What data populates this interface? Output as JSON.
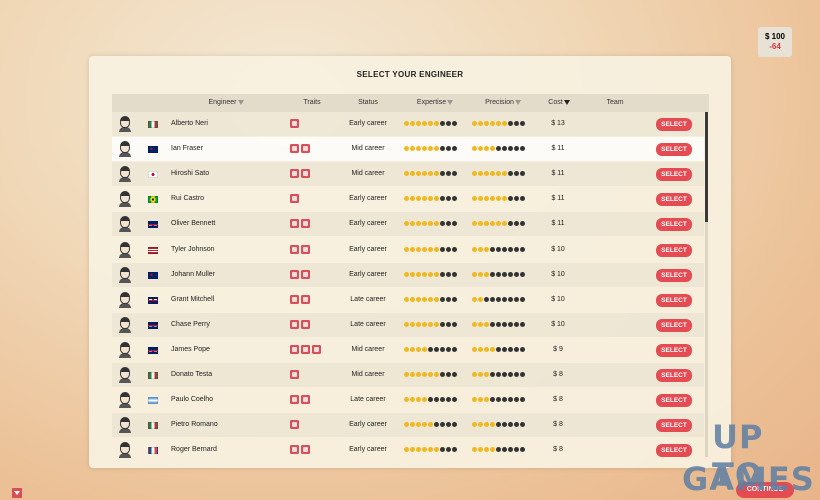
{
  "money": {
    "amount": "$ 100",
    "change": "-64"
  },
  "title": "SELECT YOUR ENGINEER",
  "columns": {
    "engineer": "Engineer",
    "traits": "Traits",
    "status": "Status",
    "expertise": "Expertise",
    "precision": "Precision",
    "cost": "Cost",
    "team": "Team"
  },
  "select_label": "SELECT",
  "continue_label": "CONTINUE",
  "watermark": {
    "line1": "UP TO",
    "line2": "GAMES"
  },
  "engineers": [
    {
      "name": "Alberto Neri",
      "flag": "italy",
      "traits": [
        "wrench-trait"
      ],
      "status": "Early career",
      "expertise": 6,
      "precision": 6,
      "cost": "$ 13"
    },
    {
      "name": "Ian Fraser",
      "flag": "australia",
      "traits": [
        "wrench-trait",
        "car-trait"
      ],
      "status": "Mid career",
      "expertise": 6,
      "precision": 4,
      "cost": "$ 11"
    },
    {
      "name": "Hiroshi Sato",
      "flag": "japan",
      "traits": [
        "car-trait",
        "thumb-trait"
      ],
      "status": "Mid career",
      "expertise": 6,
      "precision": 6,
      "cost": "$ 11"
    },
    {
      "name": "Rui Castro",
      "flag": "brazil",
      "traits": [
        "car-trait"
      ],
      "status": "Early career",
      "expertise": 6,
      "precision": 6,
      "cost": "$ 11"
    },
    {
      "name": "Oliver Bennett",
      "flag": "uk",
      "traits": [
        "car-trait",
        "chart-trait"
      ],
      "status": "Early career",
      "expertise": 6,
      "precision": 6,
      "cost": "$ 11"
    },
    {
      "name": "Tyler Johnson",
      "flag": "usa",
      "traits": [
        "case-trait",
        "thumb-trait"
      ],
      "status": "Early career",
      "expertise": 6,
      "precision": 3,
      "cost": "$ 10"
    },
    {
      "name": "Johann Muller",
      "flag": "australia",
      "traits": [
        "case-trait",
        "doc-trait"
      ],
      "status": "Early career",
      "expertise": 6,
      "precision": 3,
      "cost": "$ 10"
    },
    {
      "name": "Grant Mitchell",
      "flag": "uk",
      "traits": [
        "gear-trait",
        "chart-trait"
      ],
      "status": "Late career",
      "expertise": 6,
      "precision": 2,
      "cost": "$ 10"
    },
    {
      "name": "Chase Perry",
      "flag": "uk",
      "traits": [
        "car-trait",
        "gear-trait"
      ],
      "status": "Late career",
      "expertise": 6,
      "precision": 3,
      "cost": "$ 10"
    },
    {
      "name": "James Pope",
      "flag": "uk",
      "traits": [
        "thumb-trait",
        "case-trait",
        "bulb-trait"
      ],
      "status": "Mid career",
      "expertise": 4,
      "precision": 4,
      "cost": "$ 9"
    },
    {
      "name": "Donato Testa",
      "flag": "italy",
      "traits": [
        "wrench-trait"
      ],
      "status": "Mid career",
      "expertise": 6,
      "precision": 3,
      "cost": "$ 8"
    },
    {
      "name": "Paulo Coelho",
      "flag": "argentina",
      "traits": [
        "case-trait",
        "thumb-trait"
      ],
      "status": "Late career",
      "expertise": 4,
      "precision": 3,
      "cost": "$ 8"
    },
    {
      "name": "Pietro Romano",
      "flag": "italy",
      "traits": [
        "person-trait"
      ],
      "status": "Early career",
      "expertise": 5,
      "precision": 4,
      "cost": "$ 8"
    },
    {
      "name": "Roger Bernard",
      "flag": "france",
      "traits": [
        "thumb-trait",
        "case-trait"
      ],
      "status": "Early career",
      "expertise": 6,
      "precision": 4,
      "cost": "$ 8"
    }
  ]
}
